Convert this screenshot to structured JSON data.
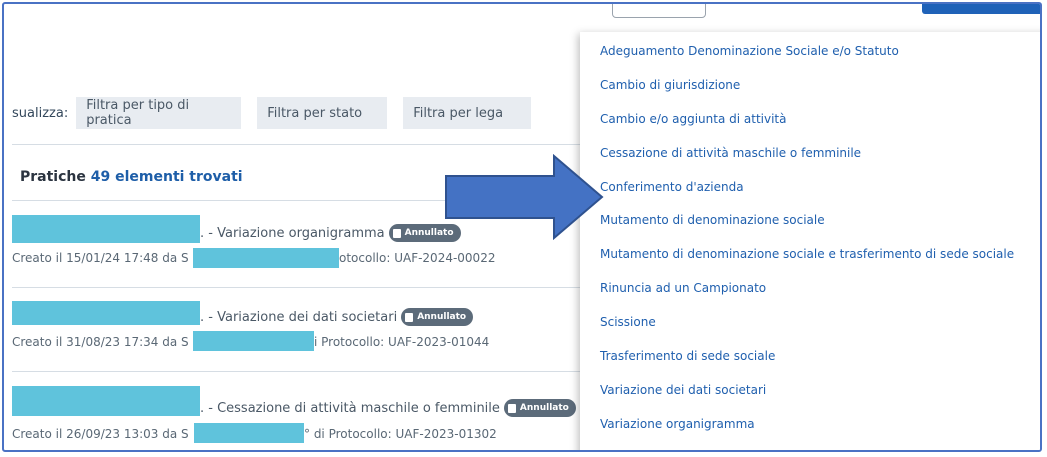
{
  "filters": {
    "visualizza_label": "sualizza:",
    "tipo": "Filtra per tipo di pratica",
    "stato": "Filtra per stato",
    "lega": "Filtra per lega"
  },
  "header": {
    "title": "Pratiche",
    "count_text": "49 elementi trovati"
  },
  "rows": [
    {
      "title": ". - Variazione organigramma",
      "badge": "Annullato",
      "created": "Creato il 15/01/24 17:48 da S",
      "protocol": "otocollo: UAF-2024-00022"
    },
    {
      "title": ". - Variazione dei dati societari",
      "badge": "Annullato",
      "created": "Creato il 31/08/23 17:34 da S",
      "protocol": "i Protocollo: UAF-2023-01044"
    },
    {
      "title": ". - Cessazione di attività maschile o femminile",
      "badge": "Annullato",
      "created": "Creato il 26/09/23 13:03 da S",
      "protocol": "° di Protocollo: UAF-2023-01302"
    }
  ],
  "dropdown": {
    "items": [
      "Adeguamento Denominazione Sociale e/o Statuto",
      "Cambio di giurisdizione",
      "Cambio e/o aggiunta di attività",
      "Cessazione di attività maschile o femminile",
      "Conferimento d'azienda",
      "Mutamento di denominazione sociale",
      "Mutamento di denominazione sociale e trasferimento di sede sociale",
      "Rinuncia ad un Campionato",
      "Scissione",
      "Trasferimento di sede sociale",
      "Variazione dei dati societari",
      "Variazione organigramma"
    ]
  },
  "colors": {
    "link": "#1f5fae",
    "count": "#1e5ea8",
    "redaction": "#5fc3dc",
    "badge_bg": "#5c6b7a",
    "arrow": "#4472c4",
    "frame_border": "#4a72c4"
  }
}
